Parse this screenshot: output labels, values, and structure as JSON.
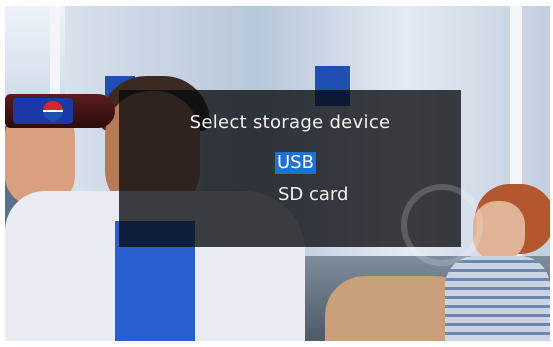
{
  "dialog": {
    "title": "Select storage device",
    "options": [
      {
        "label": "USB",
        "selected": true
      },
      {
        "label": "SD card",
        "selected": false
      }
    ]
  },
  "colors": {
    "selection_highlight": "#1e6fd8",
    "dialog_background": "#080a0e",
    "text": "#f2f2f2"
  },
  "background": {
    "bottle_logo": "pepsi-logo"
  }
}
